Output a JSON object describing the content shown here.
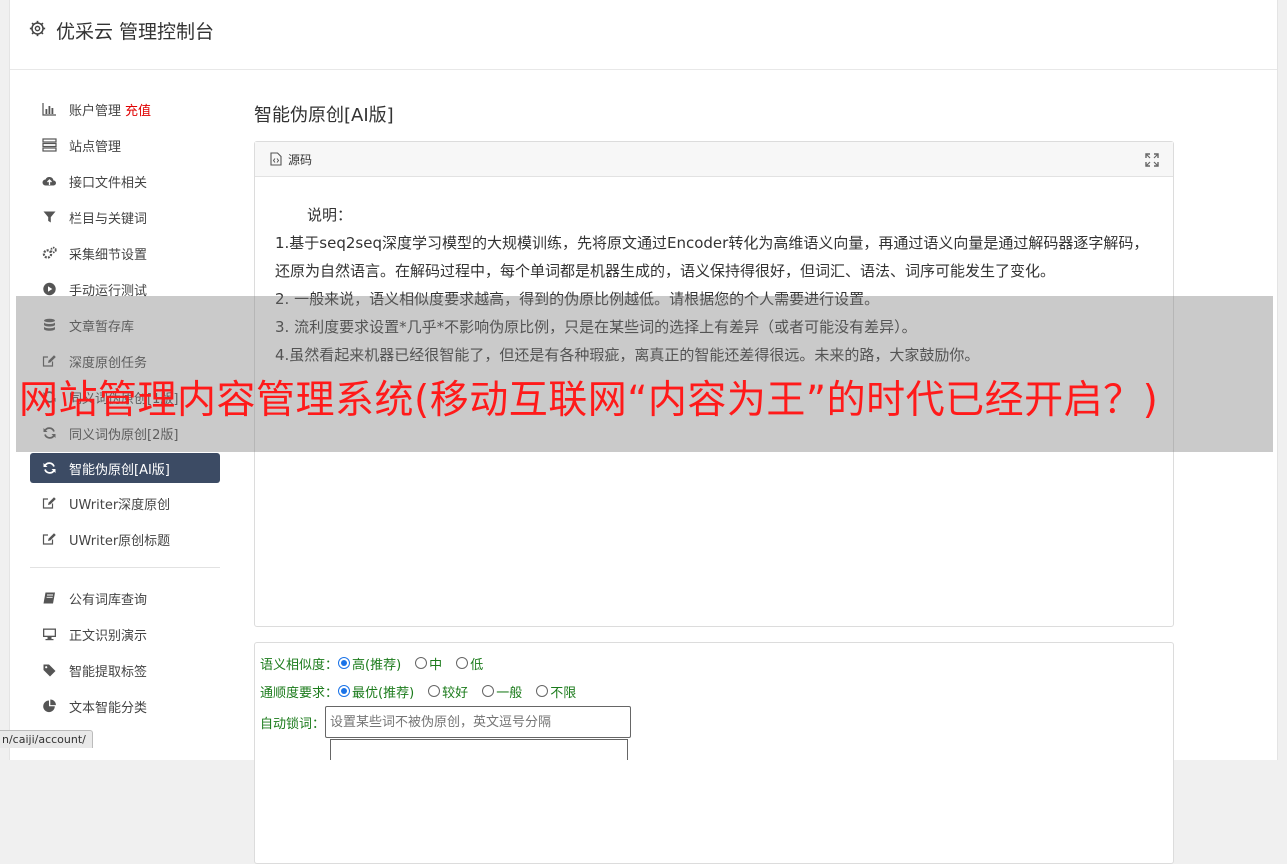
{
  "header": {
    "title": "优采云 管理控制台"
  },
  "sidebar": {
    "items": [
      {
        "label": "账户管理",
        "extra": "充值",
        "icon": "bar-chart-icon"
      },
      {
        "label": "站点管理",
        "icon": "list-icon"
      },
      {
        "label": "接口文件相关",
        "icon": "cloud-upload-icon"
      },
      {
        "label": "栏目与关键词",
        "icon": "filter-icon"
      },
      {
        "label": "采集细节设置",
        "icon": "cogs-icon"
      },
      {
        "label": "手动运行测试",
        "icon": "play-circle-icon"
      },
      {
        "label": "文章暂存库",
        "icon": "database-icon"
      },
      {
        "label": "深度原创任务",
        "icon": "edit-icon"
      },
      {
        "label": "同义词伪原创[1版]",
        "icon": "refresh-icon"
      },
      {
        "label": "同义词伪原创[2版]",
        "icon": "refresh-icon"
      },
      {
        "label": "智能伪原创[AI版]",
        "icon": "refresh-icon"
      },
      {
        "label": "UWriter深度原创",
        "icon": "edit-icon"
      },
      {
        "label": "UWriter原创标题",
        "icon": "edit-icon"
      },
      {
        "label": "公有词库查询",
        "icon": "book-icon"
      },
      {
        "label": "正文识别演示",
        "icon": "monitor-icon"
      },
      {
        "label": "智能提取标签",
        "icon": "tag-icon"
      },
      {
        "label": "文本智能分类",
        "icon": "pie-chart-icon"
      }
    ]
  },
  "main": {
    "title": "智能伪原创[AI版]",
    "panel": {
      "head_label": "源码",
      "lines": [
        "说明：",
        "1.基于seq2seq深度学习模型的大规模训练，先将原文通过Encoder转化为高维语义向量，再通过语义向量是通过解码器逐字解码，还原为自然语言。在解码过程中，每个单词都是机器生成的，语义保持得很好，但词汇、语法、词序可能发生了变化。",
        "2. 一般来说，语义相似度要求越高，得到的伪原比例越低。请根据您的个人需要进行设置。",
        "3. 流利度要求设置*几乎*不影响伪原比例，只是在某些词的选择上有差异（或者可能没有差异）。",
        "4.虽然看起来机器已经很智能了，但还是有各种瑕疵，离真正的智能还差得很远。未来的路，大家鼓励你。"
      ]
    },
    "options": {
      "similarity_label": "语义相似度：",
      "similarity_options": [
        "高(推荐)",
        "中",
        "低"
      ],
      "fluency_label": "通顺度要求：",
      "fluency_options": [
        "最优(推荐)",
        "较好",
        "一般",
        "不限"
      ],
      "lock_label": "自动锁词：",
      "lock_placeholder": "设置某些词不被伪原创，英文逗号分隔"
    }
  },
  "overlay": {
    "text": "网站管理内容管理系统(移动互联网“内容为王”的时代已经开启？)"
  },
  "status_bar": {
    "url": "n/caiji/account/"
  },
  "colors": {
    "active_nav": "#3c4b64",
    "accent_red": "#e00000",
    "option_green": "#1b7b1b",
    "radio_blue": "#1a73e8"
  }
}
